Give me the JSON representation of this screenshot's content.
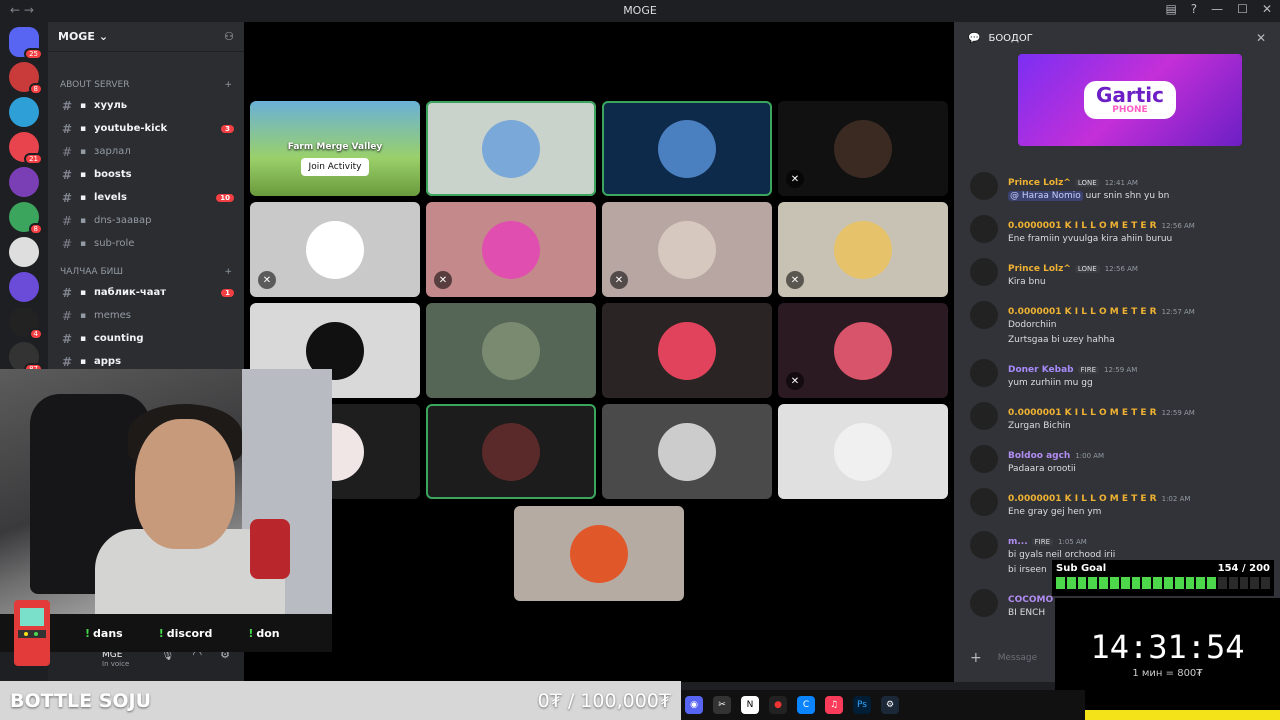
{
  "window": {
    "title": "MOGE"
  },
  "server": {
    "name": "MOGE"
  },
  "guilds": [
    {
      "color": "#5865f2",
      "badge": "25"
    },
    {
      "color": "#c93b3b",
      "badge": "8"
    },
    {
      "color": "#2f9fd7",
      "badge": ""
    },
    {
      "color": "#e8444e",
      "badge": "21"
    },
    {
      "color": "#7a3fb5",
      "badge": ""
    },
    {
      "color": "#3ba55d",
      "badge": "8"
    },
    {
      "color": "#dedede",
      "badge": ""
    },
    {
      "color": "#6a4cd8",
      "badge": ""
    },
    {
      "color": "#222",
      "badge": "4"
    },
    {
      "color": "#333",
      "badge": "87"
    },
    {
      "color": "#c7363b",
      "badge": ""
    }
  ],
  "categories": {
    "about": "ABOUT SERVER",
    "chat": "ЧАЛЧАА БИШ"
  },
  "channels_about": [
    {
      "name": "хууль",
      "bright": true,
      "count": ""
    },
    {
      "name": "youtube-kick",
      "bright": true,
      "count": "3"
    },
    {
      "name": "зарлал",
      "bright": false,
      "count": ""
    },
    {
      "name": "boosts",
      "bright": true,
      "count": ""
    },
    {
      "name": "levels",
      "bright": true,
      "count": "10"
    },
    {
      "name": "dns-заавар",
      "bright": false,
      "count": ""
    },
    {
      "name": "sub-role",
      "bright": false,
      "count": ""
    }
  ],
  "channels_chat": [
    {
      "name": "паблик-чаат",
      "bright": true,
      "count": "1"
    },
    {
      "name": "memes",
      "bright": false,
      "count": ""
    },
    {
      "name": "counting",
      "bright": true,
      "count": ""
    },
    {
      "name": "apps",
      "bright": true,
      "count": ""
    }
  ],
  "user": {
    "name": "MGE",
    "status": "In voice"
  },
  "stream_commands": [
    "dans",
    "discord",
    "don"
  ],
  "activity": {
    "title": "Farm Merge Valley",
    "join_label": "Join Activity"
  },
  "chat": {
    "title": "БООДОГ",
    "input_placeholder": "Message",
    "messages": [
      {
        "author": "Prince Lolz^",
        "color": "#f0b232",
        "tag": "LONE",
        "time": "12:41 AM",
        "mention": "@ Haraa Nomio",
        "text": "uur snin shn yu bn",
        "lines": []
      },
      {
        "author": "0.0000001 K I L L O M E T E R",
        "color": "#f0b232",
        "tag": "",
        "time": "12:56 AM",
        "mention": "",
        "text": "",
        "lines": [
          "Ene framiin yvuulga kira ahiin buruu"
        ]
      },
      {
        "author": "Prince Lolz^",
        "color": "#f0b232",
        "tag": "LONE",
        "time": "12:56 AM",
        "mention": "",
        "text": "",
        "lines": [
          "Kira bnu"
        ]
      },
      {
        "author": "0.0000001 K I L L O M E T E R",
        "color": "#f0b232",
        "tag": "",
        "time": "12:57 AM",
        "mention": "",
        "text": "",
        "lines": [
          "Dodorchiin",
          "Zurtsgaa bi uzey hahha"
        ]
      },
      {
        "author": "Doner Kebab",
        "color": "#a78bfa",
        "tag": "FIRE",
        "time": "12:59 AM",
        "mention": "",
        "text": "",
        "lines": [
          "yum zurhiin mu gg"
        ]
      },
      {
        "author": "0.0000001 K I L L O M E T E R",
        "color": "#f0b232",
        "tag": "",
        "time": "12:59 AM",
        "mention": "",
        "text": "",
        "lines": [
          "Zurgan Bichin"
        ]
      },
      {
        "author": "Boldoo agch",
        "color": "#b18cf2",
        "tag": "",
        "time": "1:00 AM",
        "mention": "",
        "text": "",
        "lines": [
          "Padaara orootii"
        ]
      },
      {
        "author": "0.0000001 K I L L O M E T E R",
        "color": "#f0b232",
        "tag": "",
        "time": "1:02 AM",
        "mention": "",
        "text": "",
        "lines": [
          "Ene gray gej hen ym"
        ]
      },
      {
        "author": "m...",
        "color": "#b18cf2",
        "tag": "FIRE",
        "time": "1:05 AM",
        "mention": "",
        "text": "",
        "lines": [
          "bi gyals neil orchood irii",
          "bi irseen"
        ]
      },
      {
        "author": "COCOMO",
        "color": "#b18cf2",
        "tag": "",
        "time": "",
        "mention": "",
        "text": "",
        "lines": [
          "BI ENCH"
        ]
      }
    ]
  },
  "sub_goal": {
    "label": "Sub Goal",
    "current": 154,
    "target": 200,
    "display": "154 / 200"
  },
  "timer": {
    "time": "14:31:54",
    "rate": "1 мин = 800₮"
  },
  "banner": {
    "name": "BOTTLE SOJU",
    "donation": "0₮ / 100,000₮"
  },
  "colors": {
    "accent": "#5865f2",
    "speaking": "#3ba55d",
    "mute_red": "#f23f43",
    "goal_green": "#4cd84a"
  }
}
